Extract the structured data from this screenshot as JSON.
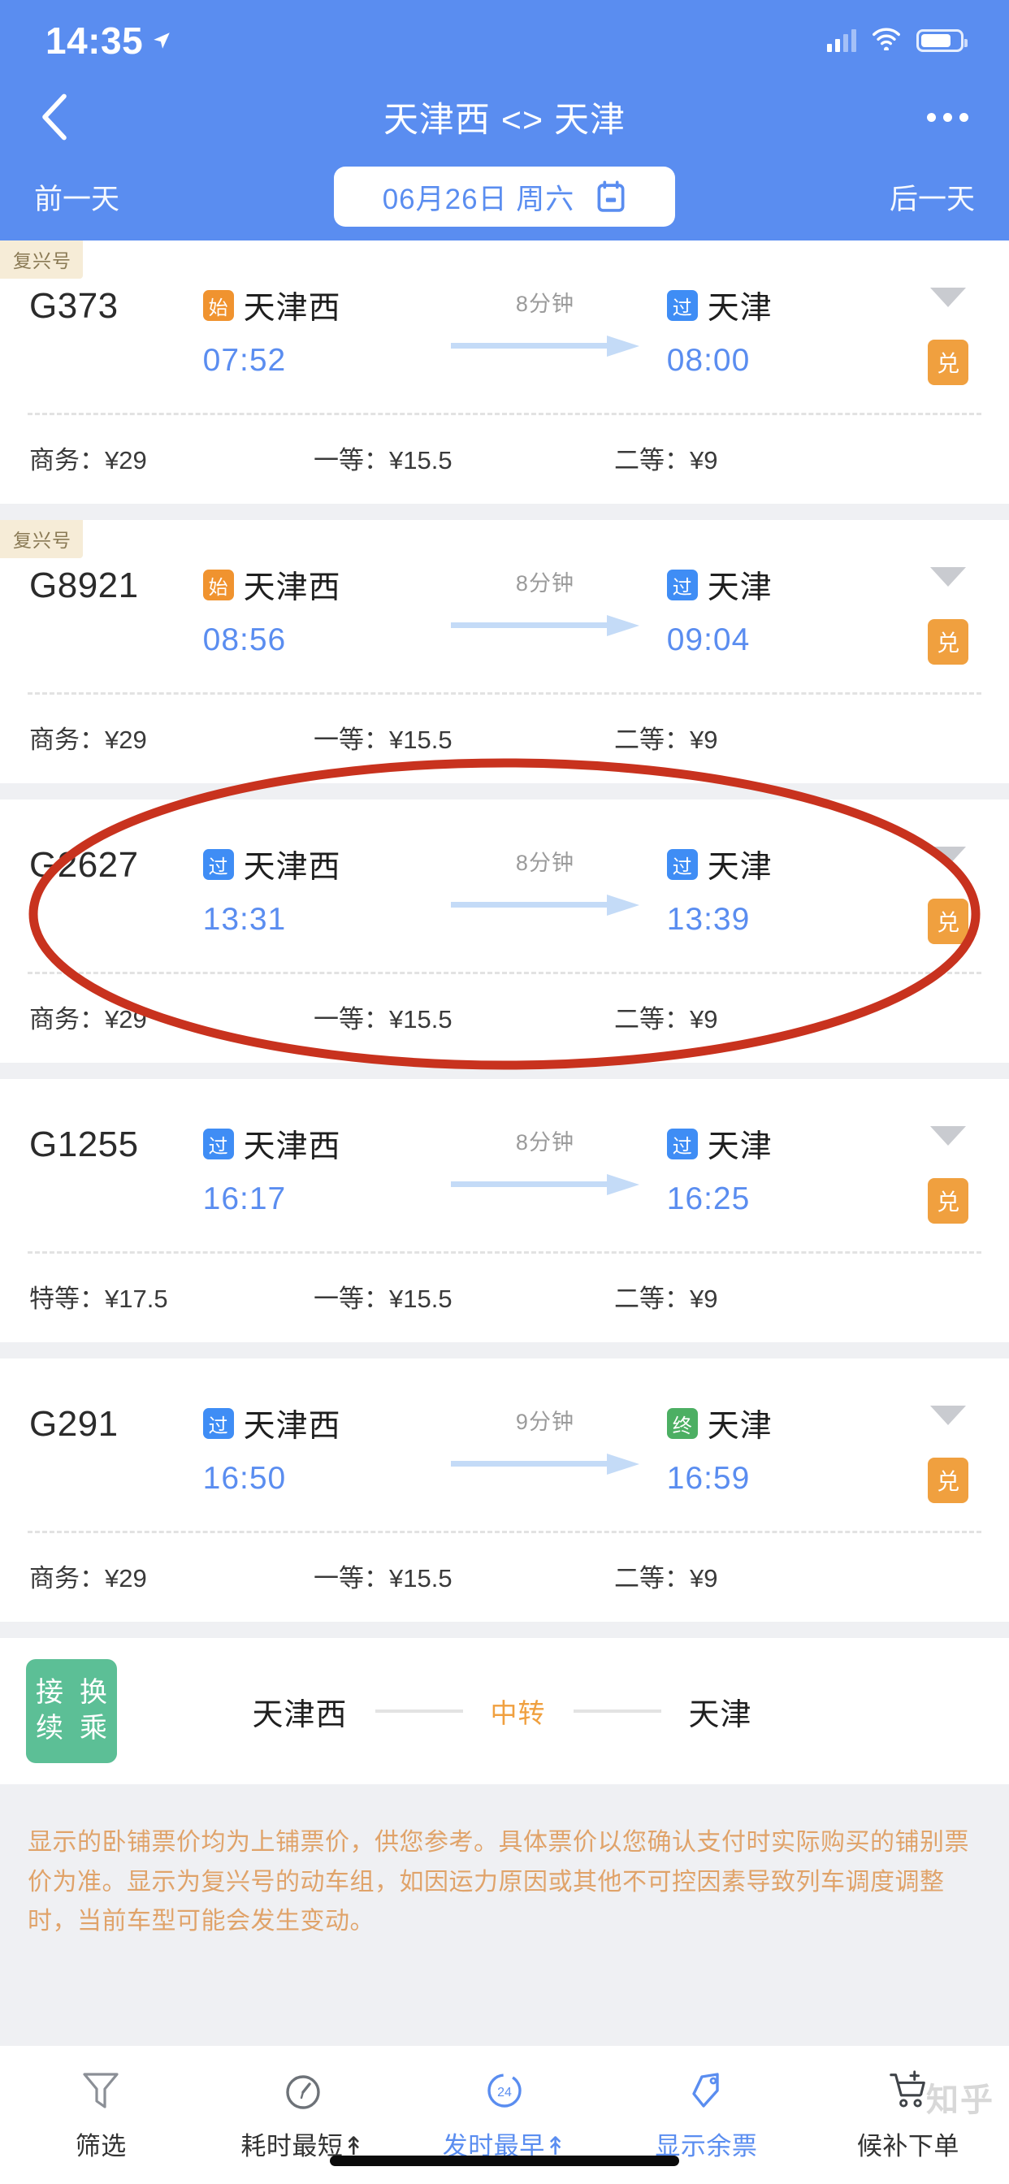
{
  "status_bar": {
    "time": "14:35",
    "location_icon": "location-arrow-icon",
    "signal_icon": "cellular-signal-icon",
    "wifi_icon": "wifi-icon",
    "battery_icon": "battery-icon"
  },
  "nav": {
    "back_icon": "chevron-left-icon",
    "title": "天津西 <> 天津",
    "more_icon": "more-horizontal-icon"
  },
  "date_bar": {
    "prev_label": "前一天",
    "date_text": "06月26日 周六",
    "calendar_icon": "calendar-icon",
    "next_label": "后一天"
  },
  "trains": [
    {
      "badge": "复兴号",
      "number": "G373",
      "from_tag": "始",
      "from_tag_type": "start",
      "from_station": "天津西",
      "from_time": "07:52",
      "duration": "8分钟",
      "to_tag": "过",
      "to_tag_type": "pass",
      "to_station": "天津",
      "to_time": "08:00",
      "expand_icon": "chevron-down-icon",
      "exchange_label": "兑",
      "prices": [
        "商务：¥29",
        "一等：¥15.5",
        "二等：¥9"
      ]
    },
    {
      "badge": "复兴号",
      "number": "G8921",
      "from_tag": "始",
      "from_tag_type": "start",
      "from_station": "天津西",
      "from_time": "08:56",
      "duration": "8分钟",
      "to_tag": "过",
      "to_tag_type": "pass",
      "to_station": "天津",
      "to_time": "09:04",
      "expand_icon": "chevron-down-icon",
      "exchange_label": "兑",
      "prices": [
        "商务：¥29",
        "一等：¥15.5",
        "二等：¥9"
      ]
    },
    {
      "badge": "",
      "number": "G2627",
      "from_tag": "过",
      "from_tag_type": "pass",
      "from_station": "天津西",
      "from_time": "13:31",
      "duration": "8分钟",
      "to_tag": "过",
      "to_tag_type": "pass",
      "to_station": "天津",
      "to_time": "13:39",
      "expand_icon": "chevron-down-icon",
      "exchange_label": "兑",
      "prices": [
        "商务：¥29",
        "一等：¥15.5",
        "二等：¥9"
      ]
    },
    {
      "badge": "",
      "number": "G1255",
      "from_tag": "过",
      "from_tag_type": "pass",
      "from_station": "天津西",
      "from_time": "16:17",
      "duration": "8分钟",
      "to_tag": "过",
      "to_tag_type": "pass",
      "to_station": "天津",
      "to_time": "16:25",
      "expand_icon": "chevron-down-icon",
      "exchange_label": "兑",
      "prices": [
        "特等：¥17.5",
        "一等：¥15.5",
        "二等：¥9"
      ]
    },
    {
      "badge": "",
      "number": "G291",
      "from_tag": "过",
      "from_tag_type": "pass",
      "from_station": "天津西",
      "from_time": "16:50",
      "duration": "9分钟",
      "to_tag": "终",
      "to_tag_type": "end",
      "to_station": "天津",
      "to_time": "16:59",
      "expand_icon": "chevron-down-icon",
      "exchange_label": "兑",
      "prices": [
        "商务：¥29",
        "一等：¥15.5",
        "二等：¥9"
      ]
    }
  ],
  "transfer": {
    "badge_chars": [
      "接",
      "换",
      "续",
      "乘"
    ],
    "from_station": "天津西",
    "middle_label": "中转",
    "to_station": "天津"
  },
  "disclaimer": "显示的卧铺票价均为上铺票价，供您参考。具体票价以您确认支付时实际购买的铺别票价为准。显示为复兴号的动车组，如因运力原因或其他不可控因素导致列车调度调整时，当前车型可能会发生变动。",
  "tabbar": [
    {
      "icon": "filter-icon",
      "label": "筛选",
      "active": false
    },
    {
      "icon": "stopwatch-icon",
      "label": "耗时最短↟",
      "active": false
    },
    {
      "icon": "clock-24-icon",
      "label": "发时最早↟",
      "active": true
    },
    {
      "icon": "ticket-tag-icon",
      "label": "显示余票",
      "active": true
    },
    {
      "icon": "cart-plus-icon",
      "label": "候补下单",
      "active": false
    }
  ],
  "annotation": {
    "shape": "ellipse-highlight",
    "color": "#c8321e",
    "target": "G2627"
  },
  "watermark": "知乎",
  "colors": {
    "header_blue": "#5a8df0",
    "time_blue": "#5a8df0",
    "tag_start_orange": "#f0932f",
    "tag_pass_blue": "#3f8df5",
    "tag_end_green": "#4caf63",
    "exchange_orange": "#f0a03f",
    "transfer_green": "#5cbf96",
    "disclaimer_orange": "#e0a36a",
    "page_bg": "#eff0f3"
  }
}
